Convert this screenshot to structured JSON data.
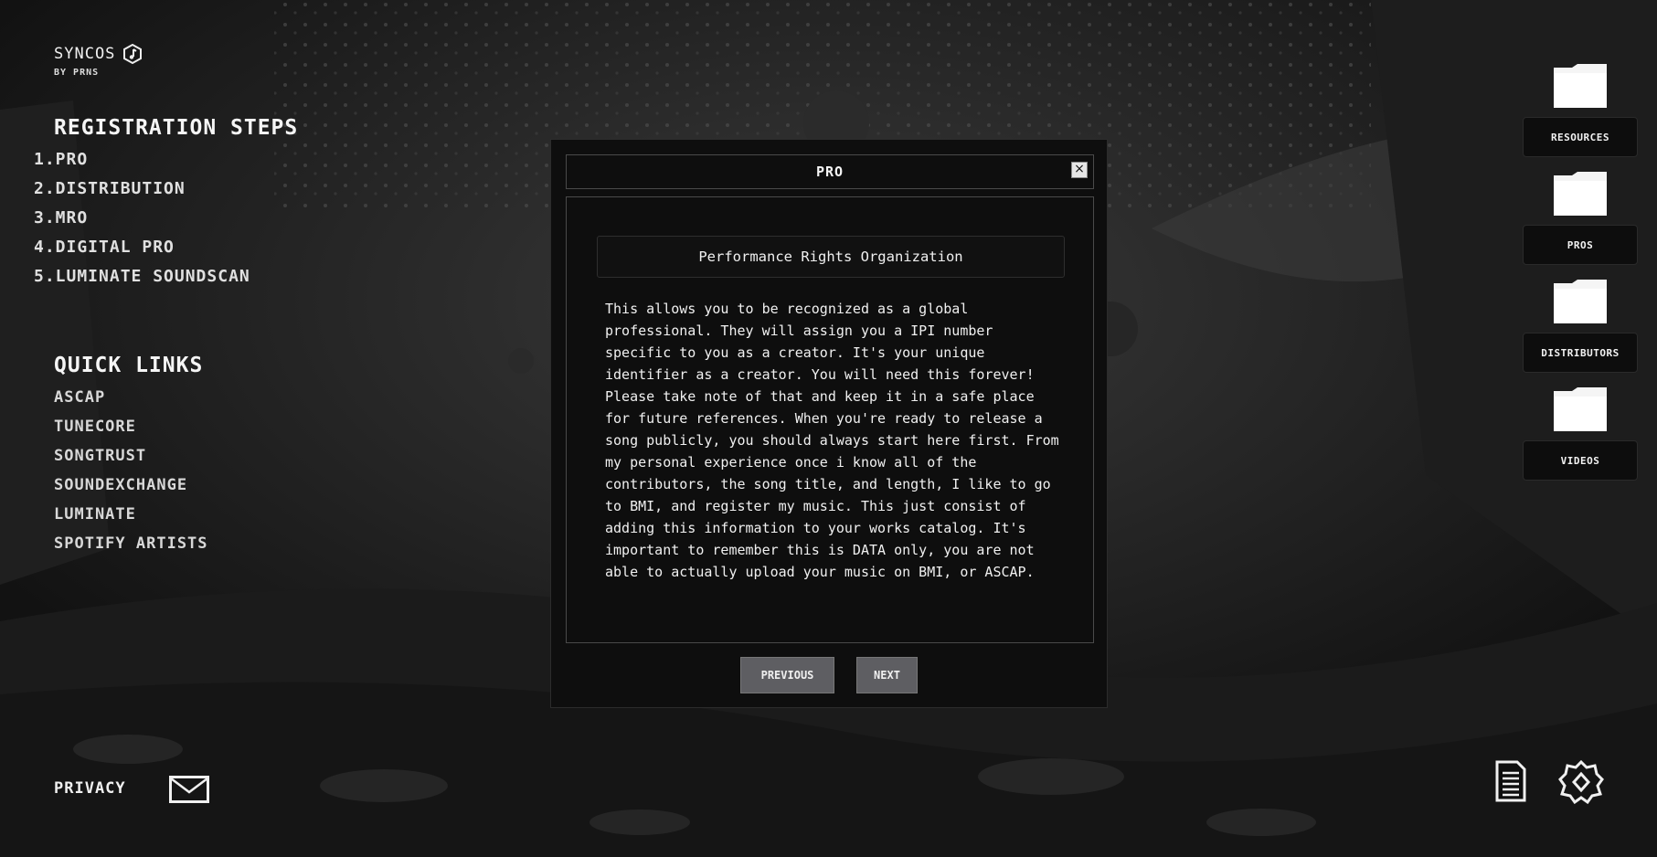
{
  "brand": {
    "name": "SYNCOS",
    "byline": "BY PRNS"
  },
  "registration": {
    "title": "REGISTRATION STEPS",
    "steps": [
      "1.PRO",
      "2.DISTRIBUTION",
      "3.MRO",
      "4.DIGITAL PRO",
      "5.LUMINATE SOUNDSCAN"
    ]
  },
  "quick_links": {
    "title": "QUICK LINKS",
    "items": [
      "ASCAP",
      "TUNECORE",
      "SONGTRUST",
      "SOUNDEXCHANGE",
      "LUMINATE",
      "SPOTIFY ARTISTS"
    ]
  },
  "footer": {
    "privacy_label": "PRIVACY"
  },
  "desktop": {
    "folders": [
      {
        "label": "RESOURCES"
      },
      {
        "label": "PROS"
      },
      {
        "label": "DISTRIBUTORS"
      },
      {
        "label": "VIDEOS"
      }
    ]
  },
  "modal": {
    "title": "PRO",
    "close_label": "×",
    "subtitle": "Performance Rights Organization",
    "body": "This allows you to be recognized as a global professional. They will assign you a IPI number specific to you as a creator. It's your unique identifier as a creator. You will need this forever! Please take note of that and keep it in a safe place for future references. When you're ready to release a song publicly, you should always start here first. From my personal experience once i know all of the contributors, the song title, and length, I like to go to BMI, and register my music. This just consist of adding this information to your works catalog. It's important to remember this is DATA only, you are not able to actually upload your music on BMI, or ASCAP.",
    "previous_label": "PREVIOUS",
    "next_label": "NEXT"
  },
  "colors": {
    "background": "#161616",
    "modal_bg": "#0e0e0e",
    "button_bg": "#5e5e62",
    "text": "#f0f0f0"
  },
  "icons": [
    "music-note-icon",
    "folder-icon",
    "mail-icon",
    "document-icon",
    "gear-icon",
    "close-icon"
  ]
}
